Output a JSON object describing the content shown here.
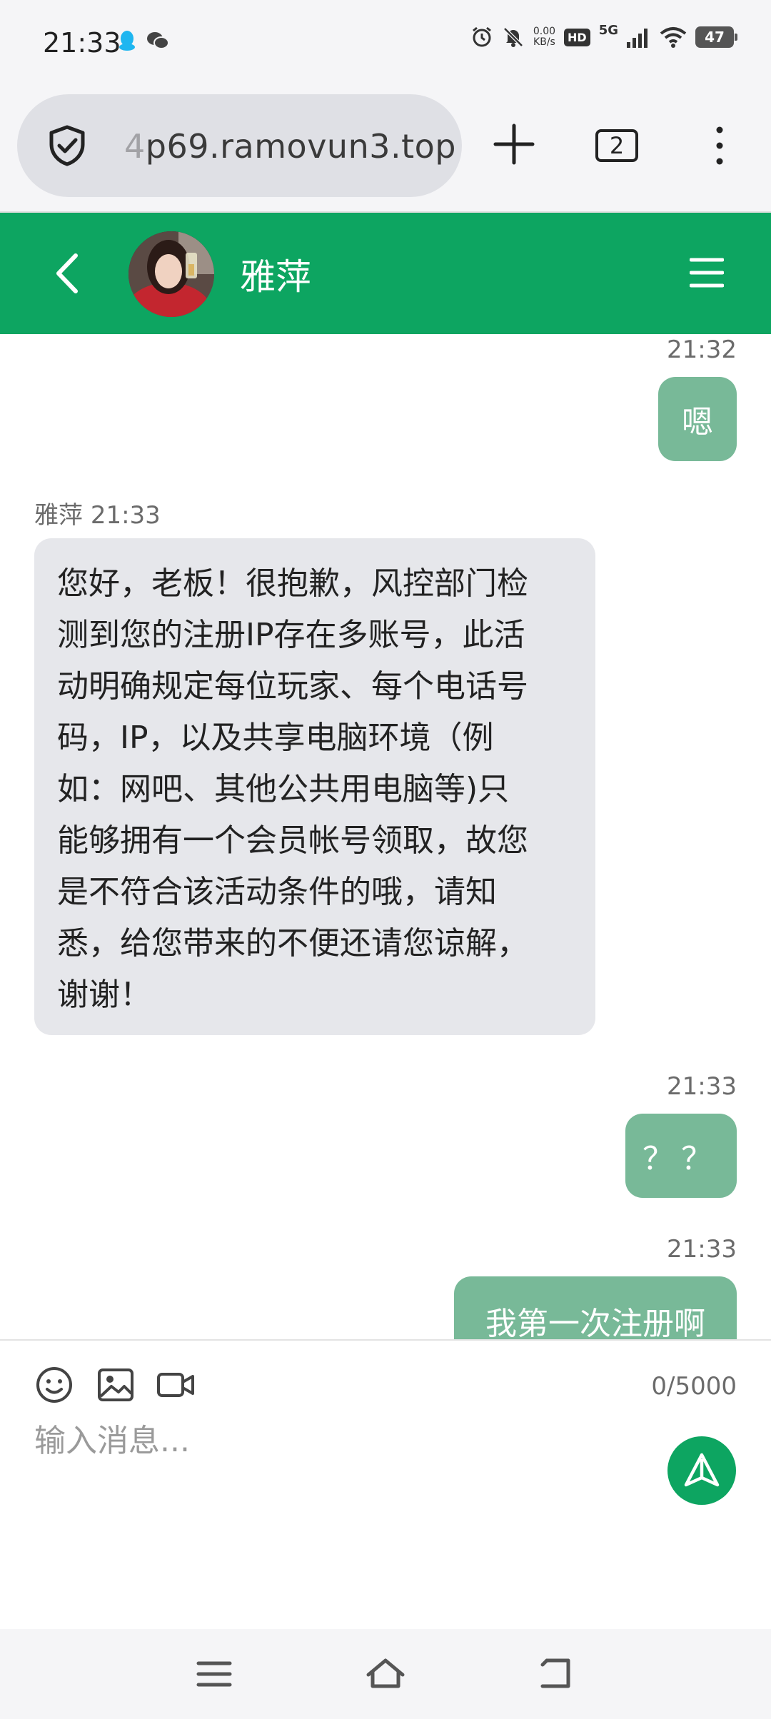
{
  "status_bar": {
    "time": "21:33",
    "net_speed_value": "0.00",
    "net_speed_unit": "KB/s",
    "hd_label": "HD",
    "network_label": "5G",
    "battery_level": "47",
    "icons": [
      "qq-icon",
      "wechat-icon",
      "alarm-icon",
      "mute-icon",
      "signal-icon",
      "wifi-icon",
      "battery-icon"
    ]
  },
  "browser": {
    "url_faded": "4",
    "url": "p69.ramovun3.top",
    "tab_count": "2",
    "icons": [
      "shield-check-icon",
      "plus-icon",
      "tabs-icon",
      "more-vertical-icon"
    ]
  },
  "chat_header": {
    "title": "雅萍",
    "accent_color": "#0da561",
    "icons": [
      "back-icon",
      "avatar",
      "menu-icon"
    ]
  },
  "messages": [
    {
      "direction": "out",
      "time": "21:32",
      "text": "嗯"
    },
    {
      "direction": "in",
      "sender": "雅萍",
      "time": "21:33",
      "lines": [
        "您好，老板！很抱歉，风控部门检",
        "测到您的注册IP存在多账号，此活",
        "动明确规定每位玩家、每个电话号",
        "码，IP，以及共享电脑环境（例",
        "如：网吧、其他公共用电脑等)只",
        "能够拥有一个会员帐号领取，故您",
        "是不符合该活动条件的哦，请知",
        "悉，给您带来的不便还请您谅解，",
        "谢谢！"
      ]
    },
    {
      "direction": "out",
      "time": "21:33",
      "text": "？？"
    },
    {
      "direction": "out",
      "time": "21:33",
      "text": "我第一次注册啊"
    }
  ],
  "composer": {
    "counter": "0/5000",
    "placeholder": "输入消息...",
    "value": "",
    "tools": [
      "emoji-icon",
      "image-icon",
      "video-icon"
    ],
    "send_icon": "send-icon"
  },
  "nav_bar": {
    "icons": [
      "recent-apps-icon",
      "home-icon",
      "back-nav-icon"
    ]
  }
}
